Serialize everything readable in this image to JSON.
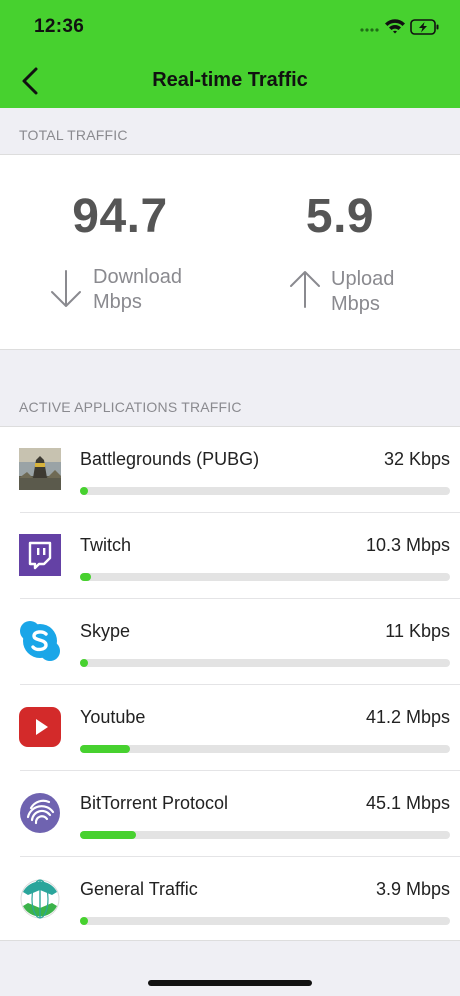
{
  "status_bar": {
    "time": "12:36"
  },
  "nav": {
    "title": "Real-time Traffic"
  },
  "total_traffic": {
    "section_title": "TOTAL TRAFFIC",
    "download": {
      "value": "94.7",
      "label_line1": "Download",
      "label_line2": "Mbps"
    },
    "upload": {
      "value": "5.9",
      "label_line1": "Upload",
      "label_line2": "Mbps"
    }
  },
  "apps": {
    "section_title": "ACTIVE APPLICATIONS TRAFFIC",
    "items": [
      {
        "name": "Battlegrounds (PUBG)",
        "rate": "32 Kbps",
        "icon": "pubg-icon",
        "progress": 0.02
      },
      {
        "name": "Twitch",
        "rate": "10.3 Mbps",
        "icon": "twitch-icon",
        "progress": 0.03
      },
      {
        "name": "Skype",
        "rate": "11 Kbps",
        "icon": "skype-icon",
        "progress": 0.02
      },
      {
        "name": "Youtube",
        "rate": "41.2 Mbps",
        "icon": "youtube-icon",
        "progress": 0.135
      },
      {
        "name": "BitTorrent Protocol",
        "rate": "45.1 Mbps",
        "icon": "bittorrent-icon",
        "progress": 0.15
      },
      {
        "name": "General Traffic",
        "rate": "3.9 Mbps",
        "icon": "globe-icon",
        "progress": 0.02
      }
    ]
  },
  "colors": {
    "accent": "#47d12f",
    "track": "#e3e3e3",
    "secondary_text": "#8a8a8f"
  }
}
